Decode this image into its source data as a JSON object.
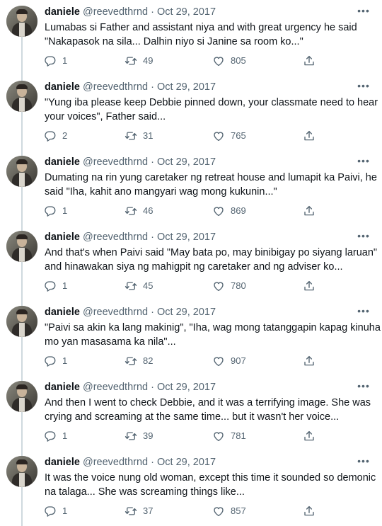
{
  "author": {
    "name": "daniele",
    "handle": "@reevedthrnd",
    "separator": "·"
  },
  "more_glyph": "•••",
  "tweets": [
    {
      "date": "Oct 29, 2017",
      "lines": [
        "Lumabas si Father and assistant niya and with great urgency he said",
        "\"Nakapasok na sila... Dalhin niyo si Janine sa room ko...\""
      ],
      "replies": "1",
      "retweets": "49",
      "likes": "805"
    },
    {
      "date": "Oct 29, 2017",
      "lines": [
        "\"Yung iba please keep Debbie pinned down, your classmate need to hear",
        "your voices\", Father said..."
      ],
      "replies": "2",
      "retweets": "31",
      "likes": "765"
    },
    {
      "date": "Oct 29, 2017",
      "lines": [
        "Dumating na rin yung caretaker ng retreat house and lumapit ka Paivi, he",
        "said \"Iha, kahit ano mangyari wag mong kukunin...\""
      ],
      "replies": "1",
      "retweets": "46",
      "likes": "869"
    },
    {
      "date": "Oct 29, 2017",
      "lines": [
        "And that's when Paivi said \"May bata po, may binibigay po siyang laruan\"",
        "and hinawakan siya ng mahigpit ng caretaker and ng adviser ko..."
      ],
      "replies": "1",
      "retweets": "45",
      "likes": "780"
    },
    {
      "date": "Oct 29, 2017",
      "lines": [
        "\"Paivi sa akin ka lang makinig\", \"Iha, wag mong tatanggapin kapag kinuha",
        "mo yan masasama ka nila\"..."
      ],
      "replies": "1",
      "retweets": "82",
      "likes": "907"
    },
    {
      "date": "Oct 29, 2017",
      "lines": [
        "And then I went to check Debbie, and it was a terrifying image. She was",
        "crying and screaming at the same time... but it wasn't her voice..."
      ],
      "replies": "1",
      "retweets": "39",
      "likes": "781"
    },
    {
      "date": "Oct 29, 2017",
      "lines": [
        "It was the voice nung old woman, except this time it sounded so demonic",
        "na talaga... She was screaming things like..."
      ],
      "replies": "1",
      "retweets": "37",
      "likes": "857"
    }
  ]
}
